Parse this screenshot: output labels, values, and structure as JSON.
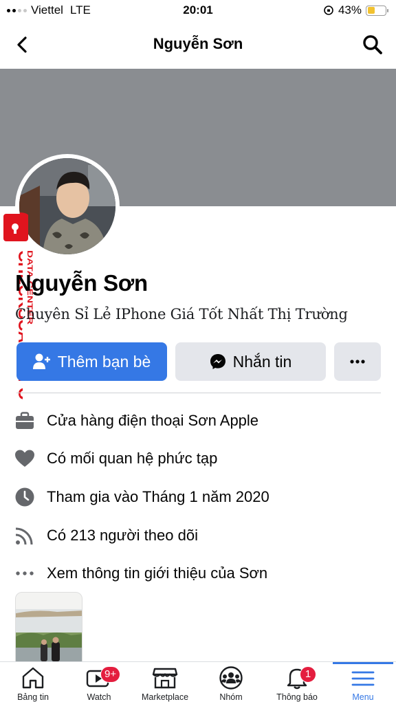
{
  "status_bar": {
    "carrier": "Viettel",
    "network": "LTE",
    "time": "20:01",
    "battery": "43%"
  },
  "header": {
    "title": "Nguyễn Sơn"
  },
  "watermark": {
    "main": "CHECKSCAM.INFO",
    "small": "DATA CENTER"
  },
  "profile": {
    "name": "Nguyễn Sơn",
    "bio": "Chuyên Sỉ Lẻ IPhone Giá Tốt Nhất Thị Trường"
  },
  "actions": {
    "add_friend": "Thêm bạn bè",
    "message": "Nhắn tin",
    "more": "..."
  },
  "info": [
    {
      "icon": "briefcase-icon",
      "text": "Cửa hàng điện thoại Sơn Apple"
    },
    {
      "icon": "heart-icon",
      "text": "Có mối quan hệ phức tạp"
    },
    {
      "icon": "clock-icon",
      "text": "Tham gia vào Tháng 1 năm 2020"
    },
    {
      "icon": "rss-icon",
      "text": "Có 213 người theo dõi"
    },
    {
      "icon": "ellipsis-icon",
      "text": "Xem thông tin giới thiệu của Sơn"
    }
  ],
  "tabs": [
    {
      "label": "Bảng tin",
      "icon": "home-icon",
      "badge": ""
    },
    {
      "label": "Watch",
      "icon": "watch-icon",
      "badge": "9+"
    },
    {
      "label": "Marketplace",
      "icon": "store-icon",
      "badge": ""
    },
    {
      "label": "Nhóm",
      "icon": "groups-icon",
      "badge": ""
    },
    {
      "label": "Thông báo",
      "icon": "bell-icon",
      "badge": "1"
    },
    {
      "label": "Menu",
      "icon": "menu-icon",
      "badge": ""
    }
  ],
  "colors": {
    "primary": "#3578e5",
    "cover": "#8a8d91",
    "badge": "#e41e3f",
    "watermark": "#e0141e"
  }
}
